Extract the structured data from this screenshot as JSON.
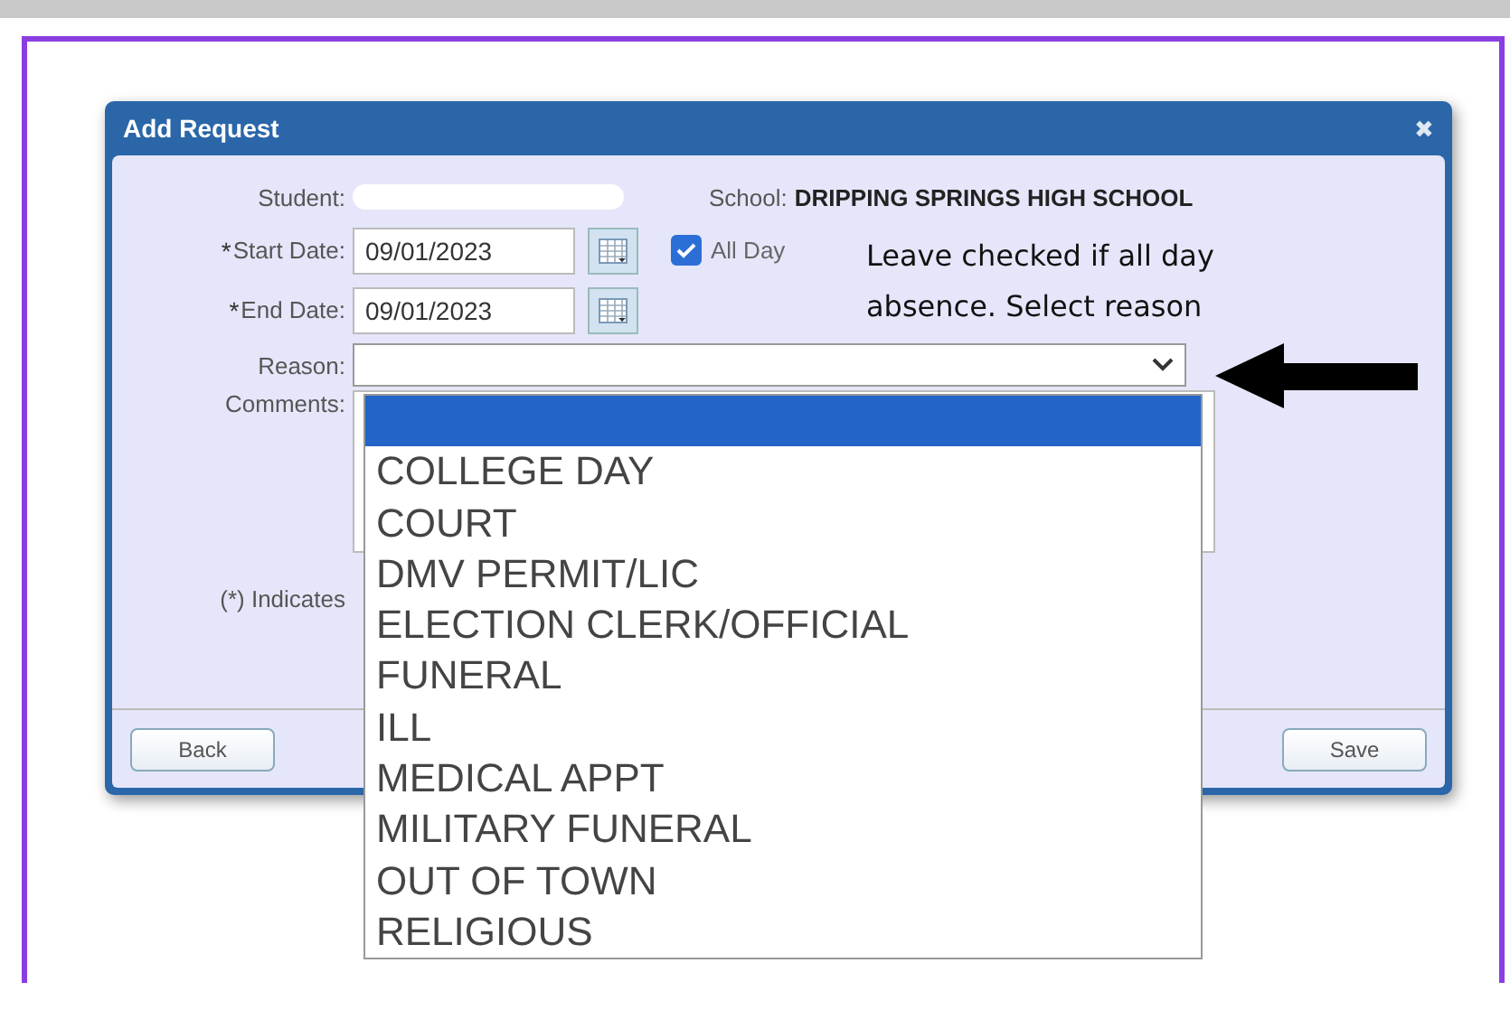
{
  "dialog": {
    "title": "Add Request",
    "close": "✖",
    "student_label": "Student:",
    "school_label": "School:",
    "school": "DRIPPING SPRINGS HIGH SCHOOL",
    "start_date": {
      "marker": "*",
      "label": "Start Date:",
      "value": "09/01/2023"
    },
    "end_date": {
      "marker": "*",
      "label": "End Date:",
      "value": "09/01/2023"
    },
    "all_day": {
      "label": "All Day",
      "checked": true
    },
    "reason_label": "Reason:",
    "comments_label": "Comments:",
    "required_note": "(*) Indicates",
    "buttons": [
      "Back",
      "Save"
    ]
  },
  "annotation": "Leave checked if all day absence.  Select reason",
  "reason_options": [
    {
      "selected": true
    },
    {
      "label": "COLLEGE DAY",
      "selected": false
    },
    {
      "label": "COURT",
      "selected": false
    },
    {
      "label": "DMV PERMIT/LIC",
      "selected": false
    },
    {
      "label": "ELECTION CLERK/OFFICIAL",
      "selected": false
    },
    {
      "label": "FUNERAL",
      "selected": false
    },
    {
      "label": "ILL",
      "selected": false
    },
    {
      "label": "MEDICAL APPT",
      "selected": false
    },
    {
      "label": "MILITARY FUNERAL",
      "selected": false
    },
    {
      "label": "OUT OF TOWN",
      "selected": false
    },
    {
      "label": "RELIGIOUS",
      "selected": false
    }
  ]
}
